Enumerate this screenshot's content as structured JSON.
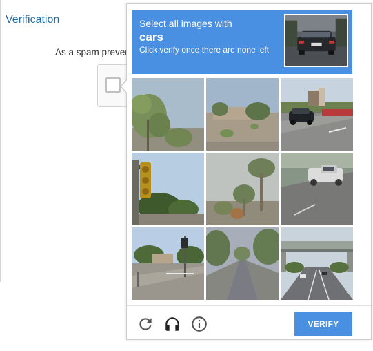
{
  "page": {
    "title": "Verification",
    "spam_text": "As a spam preven"
  },
  "challenge": {
    "header_line1": "Select all images with",
    "header_keyword": "cars",
    "header_line3": "Click verify once there are none left",
    "verify_label": "VERIFY",
    "accent_color": "#4a90e2",
    "icons": [
      "reload-icon",
      "headphones-icon",
      "info-icon"
    ],
    "tiles": [
      "tile-tree-sky",
      "tile-desert-yard",
      "tile-street-with-car",
      "tile-traffic-light",
      "tile-palm-trees",
      "tile-pickup-truck",
      "tile-intersection",
      "tile-tree-lined-road",
      "tile-highway-overpass"
    ]
  }
}
